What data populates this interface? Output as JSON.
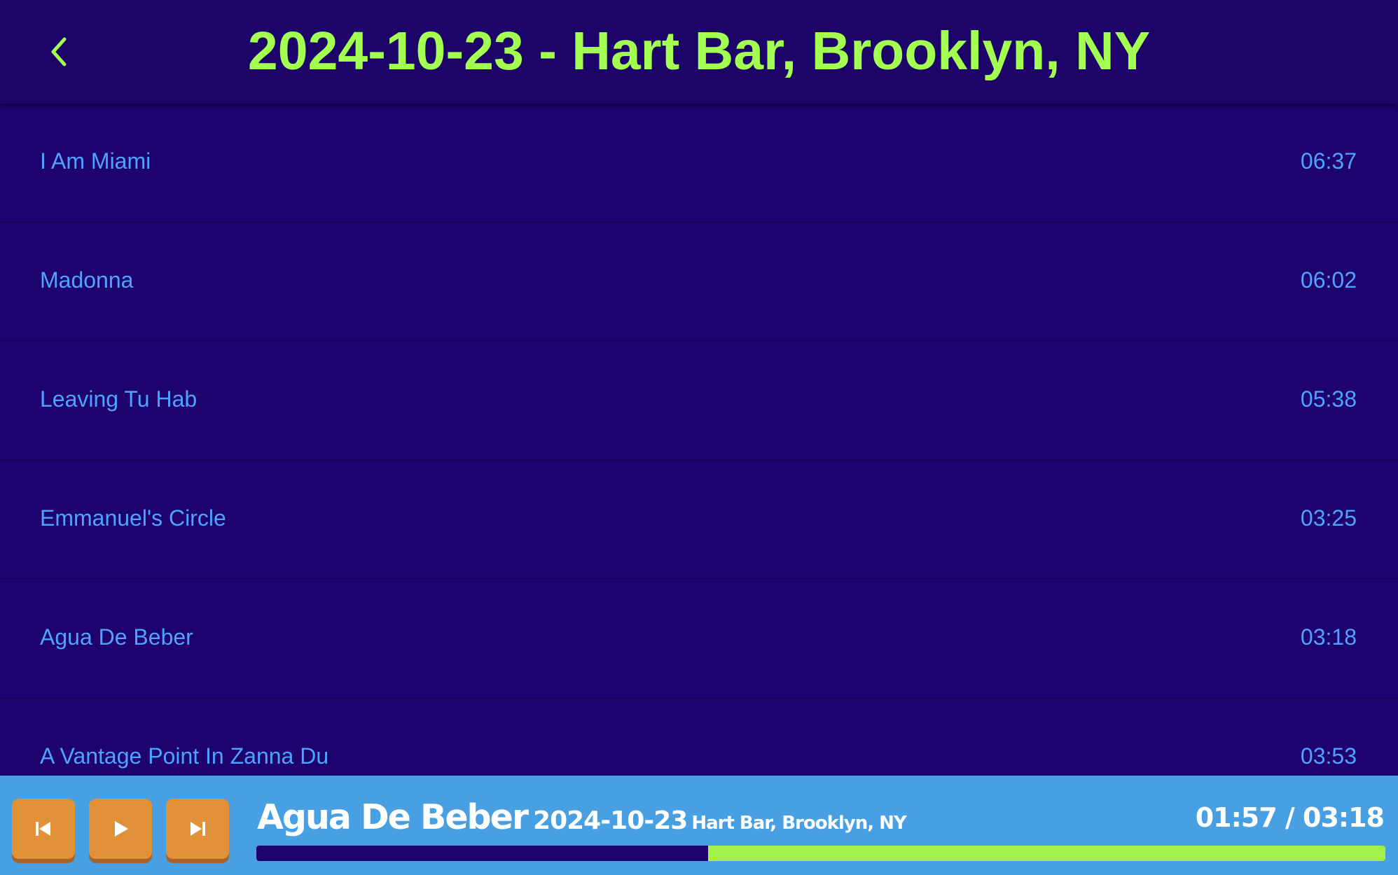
{
  "header": {
    "title": "2024-10-23 - Hart Bar, Brooklyn, NY"
  },
  "tracks": [
    {
      "name": "I Am Miami",
      "duration": "06:37"
    },
    {
      "name": "Madonna",
      "duration": "06:02"
    },
    {
      "name": "Leaving Tu Hab",
      "duration": "05:38"
    },
    {
      "name": "Emmanuel's Circle",
      "duration": "03:25"
    },
    {
      "name": "Agua De Beber",
      "duration": "03:18"
    },
    {
      "name": "A Vantage Point In Zanna Du",
      "duration": "03:53"
    }
  ],
  "player": {
    "title": "Agua De Beber",
    "date": "2024-10-23",
    "venue": "Hart Bar, Brooklyn, NY",
    "time": "01:57 / 03:18",
    "progress_fraction": 0.4,
    "buttons": {
      "prev_icon": "skip-previous-icon",
      "play_icon": "play-icon",
      "next_icon": "skip-next-icon"
    }
  },
  "colors": {
    "background": "#1e036e",
    "accent": "#a3ff50",
    "track_text": "#4fa3ff",
    "player_bar": "#48a0e2",
    "button": "#e19238"
  }
}
